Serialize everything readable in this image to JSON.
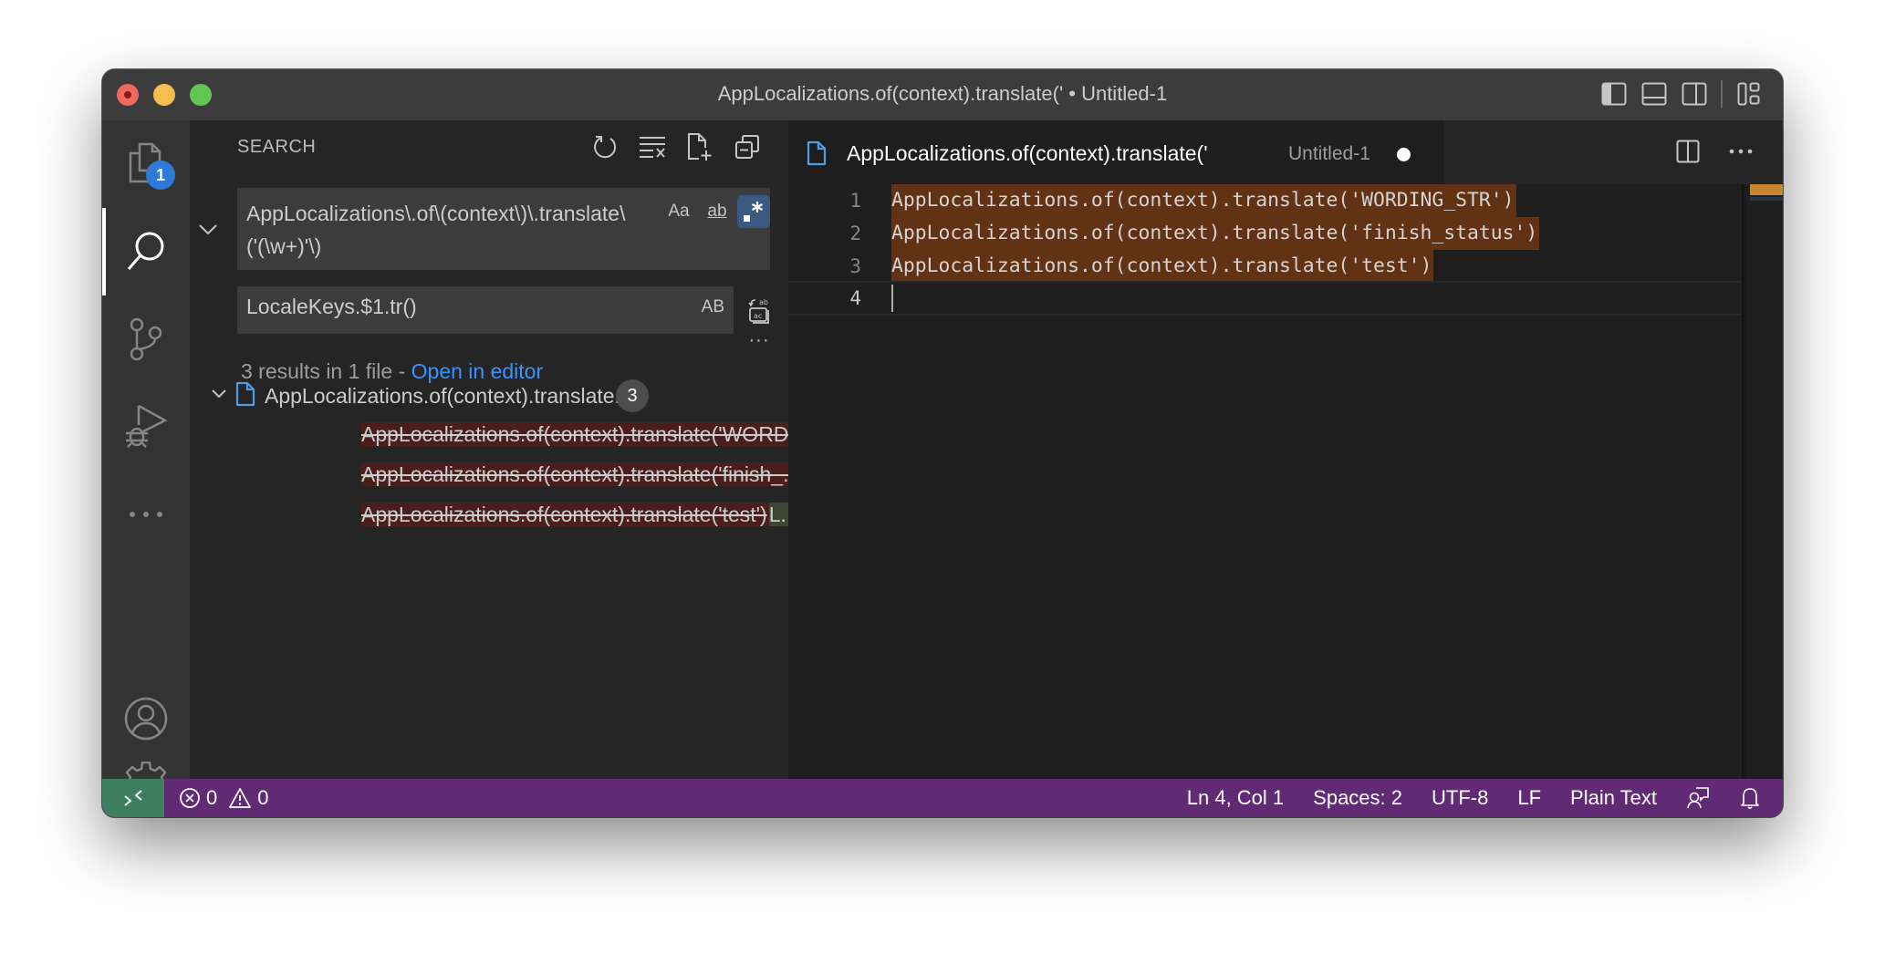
{
  "window": {
    "title": "AppLocalizations.of(context).translate(' • Untitled-1"
  },
  "titlebar": {
    "layout_icons": [
      "toggle-primary-sidebar-icon",
      "toggle-panel-icon",
      "toggle-secondary-sidebar-icon",
      "customize-layout-icon"
    ]
  },
  "activity_bar": {
    "items": [
      {
        "name": "explorer",
        "icon": "files-icon",
        "badge": "1"
      },
      {
        "name": "search",
        "icon": "search-icon",
        "active": true
      },
      {
        "name": "source-control",
        "icon": "source-control-icon"
      },
      {
        "name": "run-and-debug",
        "icon": "debug-icon"
      },
      {
        "name": "more",
        "icon": "more-icon"
      }
    ],
    "bottom": [
      {
        "name": "accounts",
        "icon": "account-icon"
      },
      {
        "name": "manage",
        "icon": "gear-icon"
      }
    ]
  },
  "search": {
    "title": "SEARCH",
    "actions": [
      "refresh-icon",
      "clear-results-icon",
      "new-search-editor-icon",
      "collapse-all-icon"
    ],
    "query": "AppLocalizations\\.of\\(context\\)\\.translate\\('(\\w+)'\\)",
    "options": {
      "match_case": "Aa",
      "whole_word": "ab",
      "regex": ".*"
    },
    "replace": "LocaleKeys.$1.tr()",
    "replace_option": "AB",
    "more": "···",
    "summary": "3 results in 1 file - ",
    "open_in_editor": "Open in editor",
    "file": {
      "name": "AppLocalizations.of(context).translate...",
      "count": "3"
    },
    "matches": [
      {
        "old": "AppLocalizations.of(context).translate('WORD...",
        "new": ""
      },
      {
        "old": "AppLocalizations.of(context).translate('finish_...",
        "new": ""
      },
      {
        "old": "AppLocalizations.of(context).translate('test')",
        "new": "L..."
      }
    ]
  },
  "editor": {
    "tab": {
      "name": "AppLocalizations.of(context).translate('",
      "description": "Untitled-1",
      "dirty": true
    },
    "actions": [
      "split-editor-icon",
      "more-actions-icon"
    ],
    "lines": [
      {
        "number": "1",
        "text": "AppLocalizations.of(context).translate('WORDING_STR')"
      },
      {
        "number": "2",
        "text": "AppLocalizations.of(context).translate('finish_status')"
      },
      {
        "number": "3",
        "text": "AppLocalizations.of(context).translate('test')"
      },
      {
        "number": "4",
        "text": ""
      }
    ]
  },
  "statusbar": {
    "errors": "0",
    "warnings": "0",
    "position": "Ln 4, Col 1",
    "indent": "Spaces: 2",
    "encoding": "UTF-8",
    "eol": "LF",
    "language": "Plain Text"
  },
  "colors": {
    "statusbar": "#612a75",
    "remote": "#3c7e5d",
    "accent": "#3794ff",
    "find_match": "#613214",
    "badge": "#2f7ad6"
  }
}
